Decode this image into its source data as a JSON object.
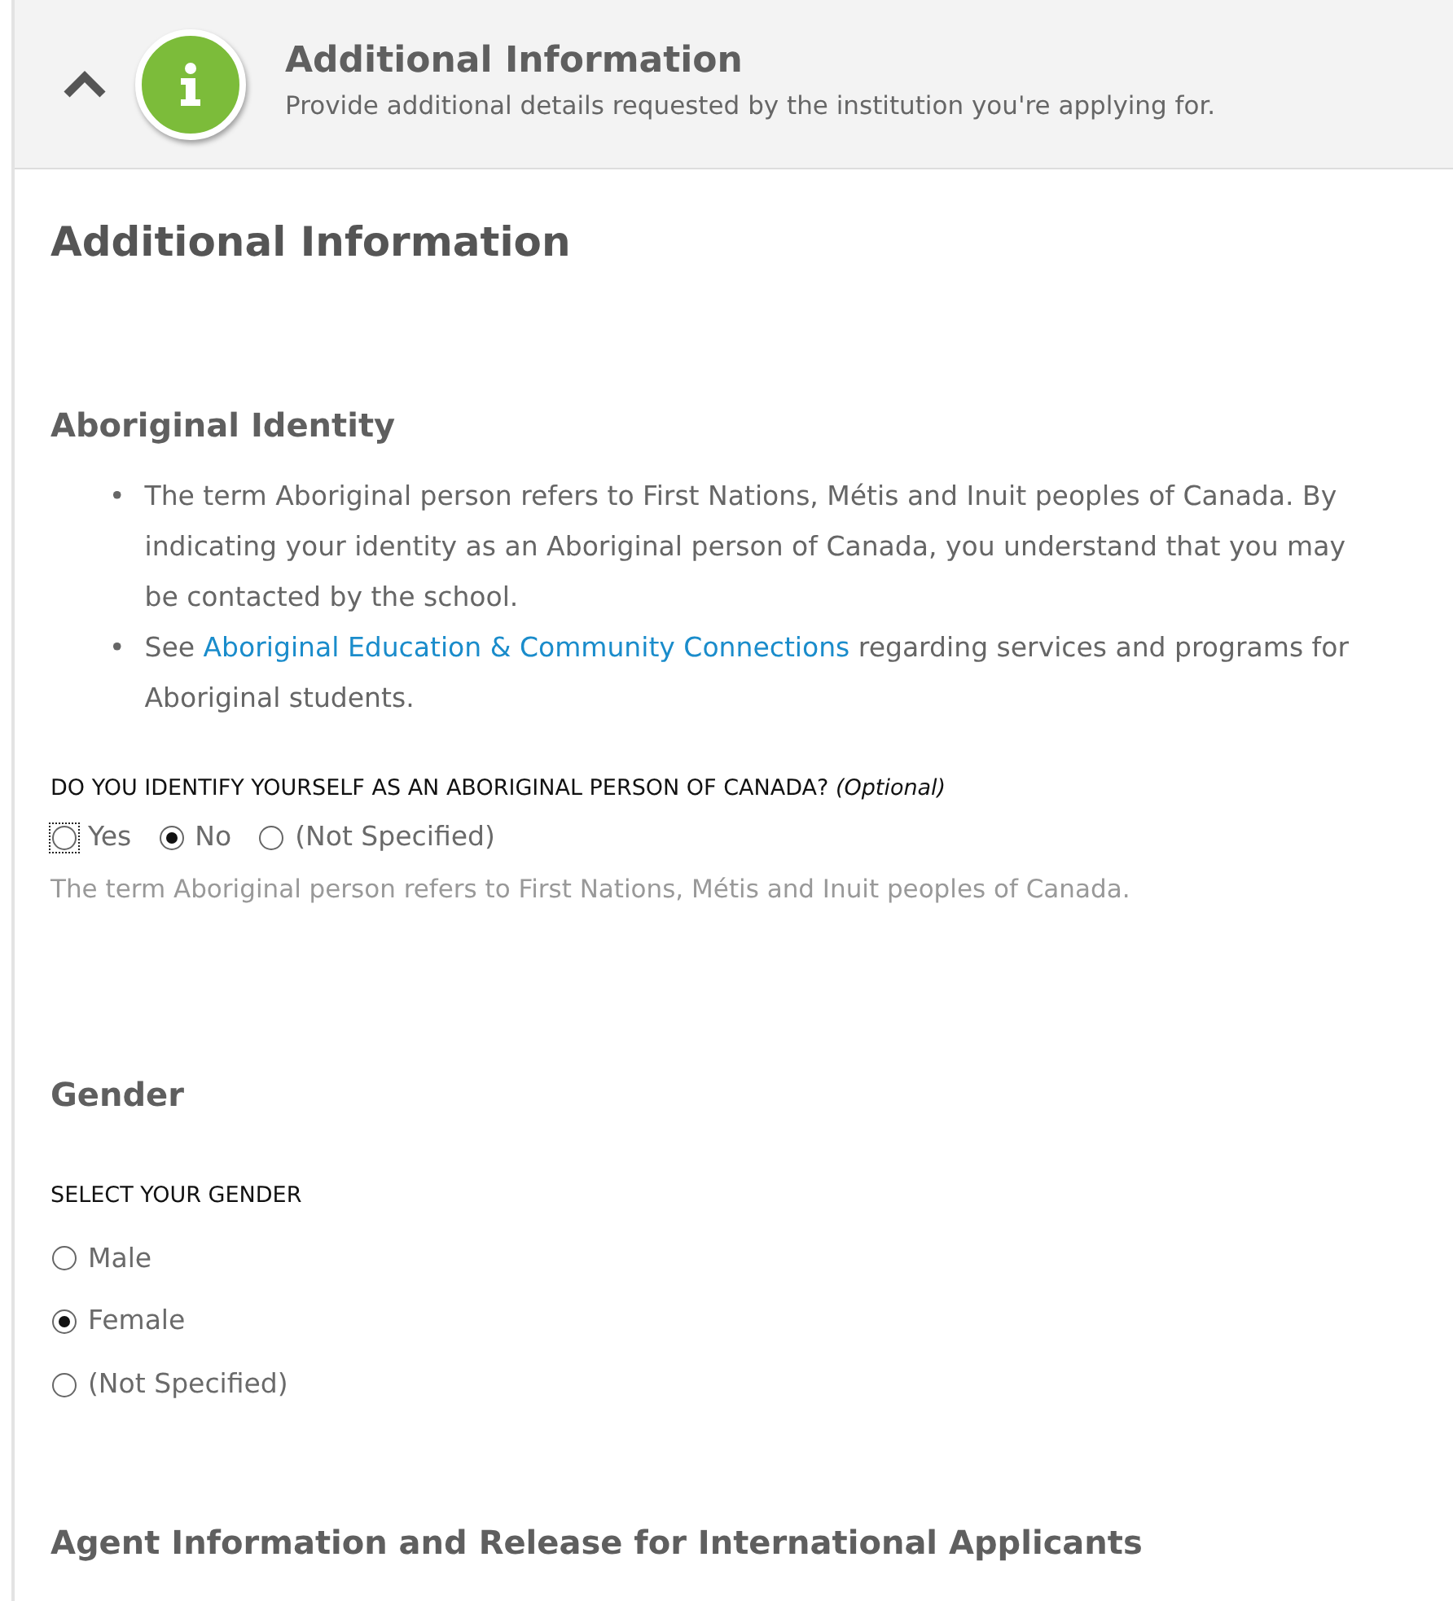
{
  "header": {
    "title": "Additional Information",
    "subtitle": "Provide additional details requested by the institution you're applying for.",
    "expanded": true
  },
  "page_title": "Additional Information",
  "sections": [
    {
      "kind": "aboriginal",
      "title": "Aboriginal Identity",
      "bullets": [
        {
          "marker": "•",
          "before": "The term Aboriginal person refers to First Nations, Métis and Inuit peoples of Canada. By indicating your identity as an Aboriginal person of Canada, you understand that you may be contacted by the school."
        },
        {
          "marker": "•",
          "before": "See ",
          "link": "Aboriginal Education & Community Connections",
          "after": " regarding services and programs for Aboriginal students."
        }
      ],
      "question": "DO YOU IDENTIFY YOURSELF AS AN ABORIGINAL PERSON OF CANADA? *(Optional)*",
      "options": [
        {
          "label": "Yes",
          "selected": false,
          "focused": true
        },
        {
          "label": "No",
          "selected": true,
          "focused": false
        },
        {
          "label": "(Not Specified)",
          "selected": false,
          "focused": false
        }
      ],
      "hint": "The term Aboriginal person refers to First Nations, Métis and Inuit peoples of Canada."
    },
    {
      "kind": "gender",
      "title": "Gender",
      "question": "SELECT YOUR GENDER",
      "options": [
        {
          "label": "Male",
          "selected": false,
          "focused": false
        },
        {
          "label": "Female",
          "selected": true,
          "focused": false
        },
        {
          "label": "(Not Specified)",
          "selected": false,
          "focused": false
        }
      ]
    },
    {
      "kind": "agent",
      "title": "Agent Information and Release for International Applicants"
    }
  ]
}
